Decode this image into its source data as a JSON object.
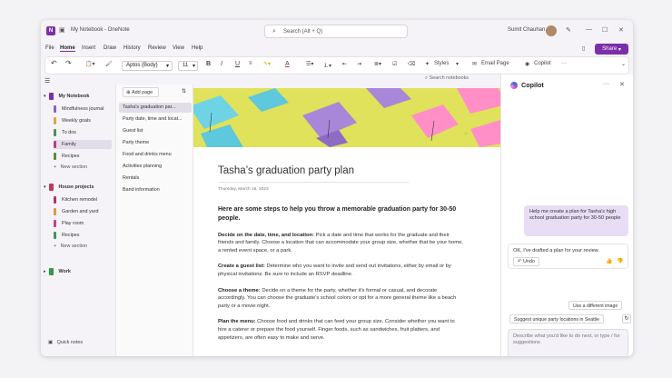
{
  "app": {
    "window_title": "My Notebook - OneNote",
    "search_placeholder": "Search (Alt + Q)",
    "user_name": "Sumit Chauhan",
    "share_label": "Share"
  },
  "menu": [
    "File",
    "Home",
    "Insert",
    "Draw",
    "History",
    "Review",
    "View",
    "Help"
  ],
  "toolbar": {
    "font": "Aptos (Body)",
    "size": "11",
    "bold": "B",
    "italic": "I",
    "underline": "U",
    "font_color": "A",
    "styles_label": "Styles",
    "email_label": "Email Page",
    "copilot_label": "Copilot",
    "more": "···"
  },
  "search_notebooks": "Search notebooks",
  "notebooks": [
    {
      "name": "My Notebook",
      "color": "#7b2fa8",
      "sections": [
        {
          "name": "Mindfulness journal",
          "color": "#8c5fd1"
        },
        {
          "name": "Weekly goals",
          "color": "#e0a832"
        },
        {
          "name": "To dos",
          "color": "#3b9b57"
        },
        {
          "name": "Family",
          "color": "#c2398a",
          "selected": true
        },
        {
          "name": "Recipes",
          "color": "#5b8f3a"
        }
      ],
      "add_label": "New section"
    },
    {
      "name": "House projects",
      "color": "#c23a5a",
      "sections": [
        {
          "name": "Kitchen remodel",
          "color": "#b4306a"
        },
        {
          "name": "Garden and yard",
          "color": "#e09a32"
        },
        {
          "name": "Play room",
          "color": "#d5388a"
        },
        {
          "name": "Recipes",
          "color": "#3b9b57"
        }
      ],
      "add_label": "New section"
    },
    {
      "name": "Work",
      "color": "#2f9b45",
      "sections": [],
      "add_label": ""
    }
  ],
  "quick_notes": "Quick notes",
  "pages": {
    "add_label": "Add page",
    "items": [
      {
        "title": "Tasha's graduation par...",
        "selected": true
      },
      {
        "title": "Party date, time and locat..."
      },
      {
        "title": "Guest list"
      },
      {
        "title": "Party theme"
      },
      {
        "title": "Food and drinks menu"
      },
      {
        "title": "Activities planning"
      },
      {
        "title": "Rentals"
      },
      {
        "title": "Band information"
      }
    ]
  },
  "note": {
    "title": "Tasha’s graduation party plan",
    "date": "Thursday, March 16, 2023",
    "lead": "Here are some steps to help you throw a memorable graduation party for 30-50 people.",
    "paragraphs": [
      {
        "head": "Decide on the date, time, and location:",
        "body": " Pick a date and time that works for the graduate and their friends and family. Choose a location that can accommodate your group size, whether that be your home, a rented event space, or a park."
      },
      {
        "head": "Create a guest list:",
        "body": " Determine who you want to invite and send out invitations, either by email or by physical invitations. Be sure to include an RSVP deadline."
      },
      {
        "head": "Choose a theme:",
        "body": " Decide on a theme for the party, whether it's formal or casual, and decorate accordingly. You can choose the graduate's school colors or opt for a more general theme like a beach party or a movie night."
      },
      {
        "head": "Plan the menu:",
        "body": " Choose food and drinks that can feed your group size. Consider whether you want to hire a caterer or prepare the food yourself. Finger foods, such as sandwiches, fruit platters, and appetizers, are often easy to make and serve."
      }
    ]
  },
  "copilot": {
    "title": "Copilot",
    "user_message": "Help me create a plan for Tasha's high school graduation party for 30-50 people",
    "bot_message": "OK, I've drafted a plan for your review.",
    "undo_label": "Undo",
    "chip_image": "Use a different image",
    "chip_suggest": "Suggest unique party locations in Seattle",
    "composer_placeholder": "Describe what you'd like to do next, or type / for suggestions"
  },
  "colors": {
    "accent": "#7b2fa8",
    "copilot_bubble": "#e7def5",
    "hero_bg": "#dfe25a"
  }
}
